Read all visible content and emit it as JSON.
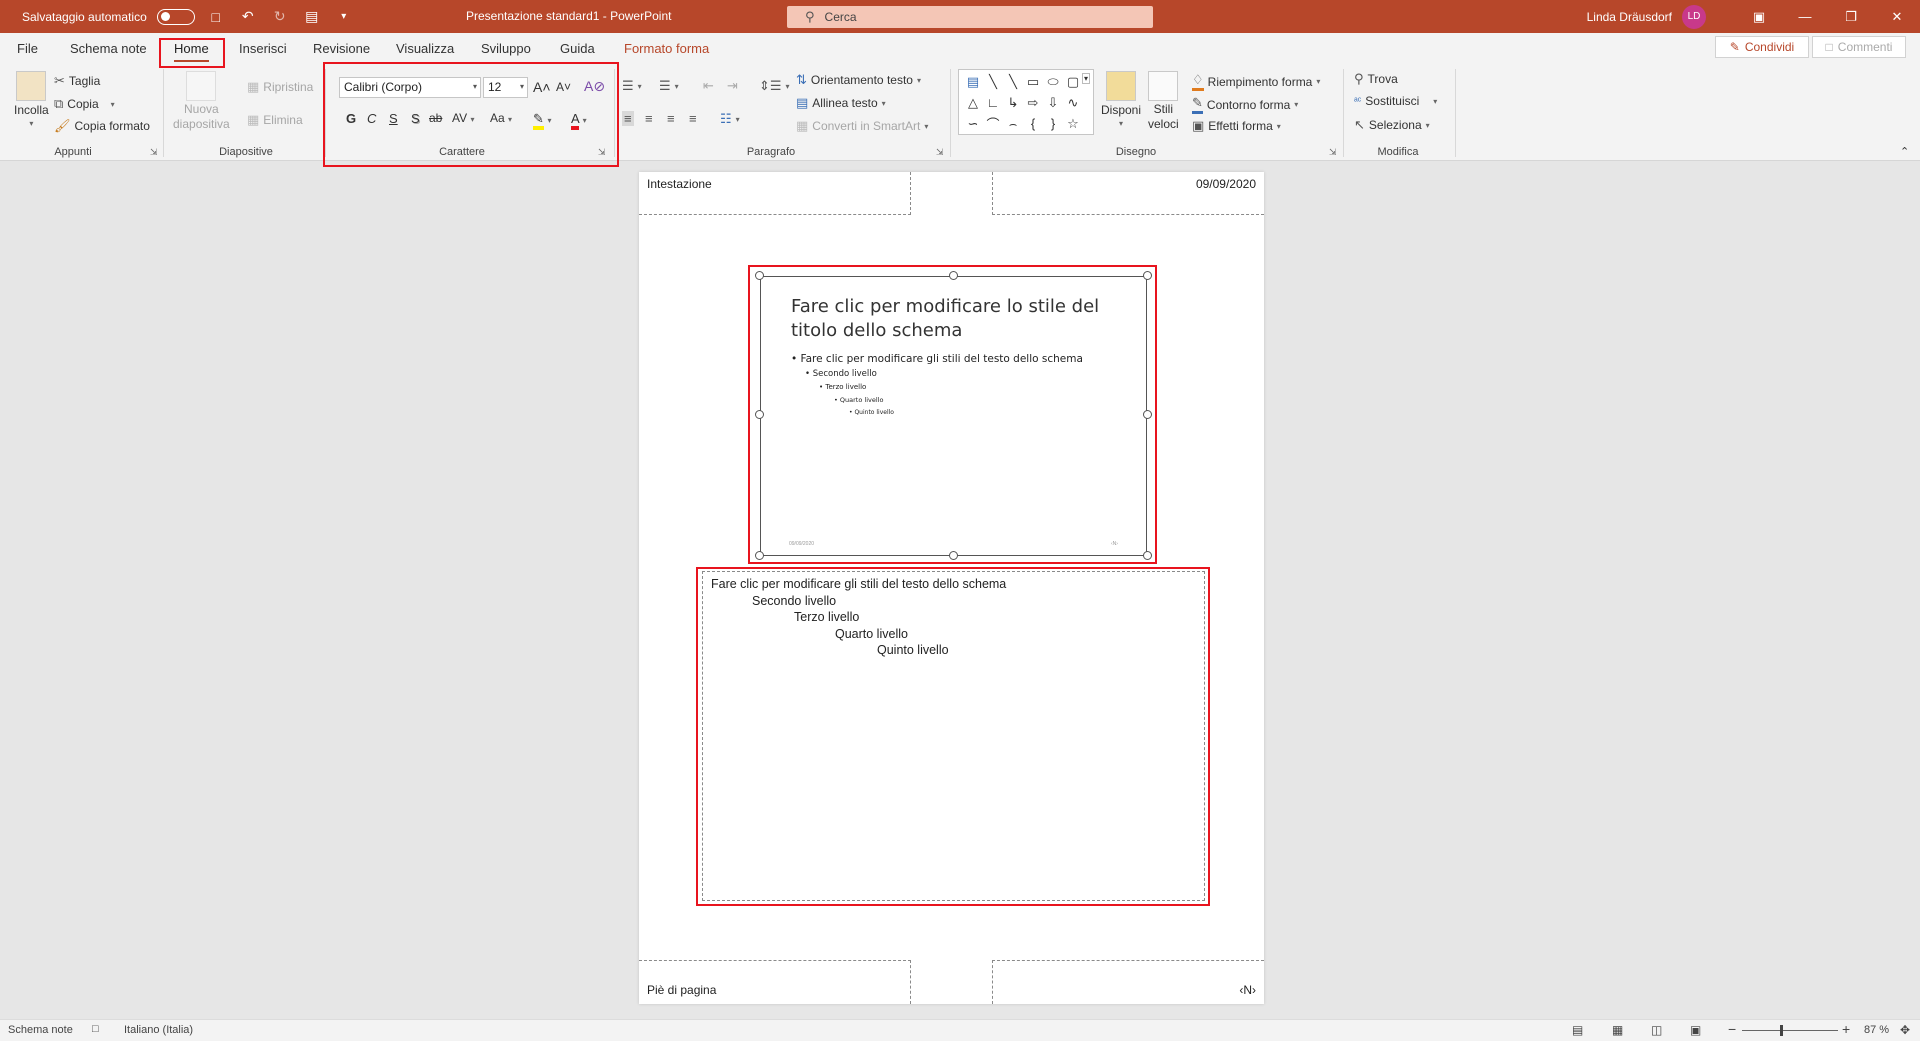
{
  "titlebar": {
    "autosave_label": "Salvataggio automatico",
    "document_title": "Presentazione standard1  -  PowerPoint",
    "search_placeholder": "Cerca",
    "user_name": "Linda Dräusdorf",
    "user_initials": "LD",
    "icons": [
      "save-icon",
      "undo-icon",
      "redo-icon",
      "present-icon",
      "customize-qat-icon"
    ]
  },
  "tabs": [
    {
      "label": "File"
    },
    {
      "label": "Schema note"
    },
    {
      "label": "Home"
    },
    {
      "label": "Inserisci"
    },
    {
      "label": "Revisione"
    },
    {
      "label": "Visualizza"
    },
    {
      "label": "Sviluppo"
    },
    {
      "label": "Guida"
    },
    {
      "label": "Formato forma"
    }
  ],
  "share": {
    "share_label": "Condividi",
    "comments_label": "Commenti"
  },
  "ribbon": {
    "clipboard": {
      "paste": "Incolla",
      "cut": "Taglia",
      "copy": "Copia",
      "format_painter": "Copia formato",
      "group": "Appunti"
    },
    "slides": {
      "new_slide_1": "Nuova",
      "new_slide_2": "diapositiva",
      "reset": "Ripristina",
      "delete": "Elimina",
      "group": "Diapositive"
    },
    "font": {
      "font_name": "Calibri (Corpo)",
      "font_size": "12",
      "grow": "A˄",
      "shrink": "A˅",
      "bold": "G",
      "italic": "C",
      "underline": "S",
      "shadow": "S",
      "strike": "ab",
      "spacing": "AV",
      "case": "Aa",
      "color_letter": "A",
      "group": "Carattere",
      "highlight_color": "#ffef00",
      "font_color": "#e8141e"
    },
    "paragraph": {
      "text_direction": "Orientamento testo",
      "align_text": "Allinea testo",
      "smartart": "Converti in SmartArt",
      "group": "Paragrafo"
    },
    "drawing": {
      "arrange": "Disponi",
      "quick_styles_1": "Stili",
      "quick_styles_2": "veloci",
      "shape_fill": "Riempimento forma",
      "shape_outline": "Contorno forma",
      "shape_effects": "Effetti forma",
      "group": "Disegno"
    },
    "editing": {
      "find": "Trova",
      "replace": "Sostituisci",
      "select": "Seleziona",
      "group": "Modifica"
    }
  },
  "notes_page": {
    "header": "Intestazione",
    "date": "09/09/2020",
    "footer": "Piè di pagina",
    "page_number": "‹N›",
    "slide": {
      "title": "Fare clic per modificare lo stile del titolo dello schema",
      "bullets": [
        "• Fare clic per modificare gli stili del testo dello schema",
        "• Secondo livello",
        "• Terzo livello",
        "• Quarto livello",
        "• Quinto livello"
      ],
      "footer_date": "09/09/2020",
      "footer_num": "‹N›"
    },
    "notes": [
      "Fare clic per modificare gli stili del testo dello schema",
      "Secondo livello",
      "Terzo livello",
      "Quarto livello",
      "Quinto livello"
    ]
  },
  "statusbar": {
    "view": "Schema note",
    "language": "Italiano (Italia)",
    "zoom": "87 %"
  },
  "colors": {
    "accent": "#b7472a",
    "highlight_box": "#e8141e"
  }
}
